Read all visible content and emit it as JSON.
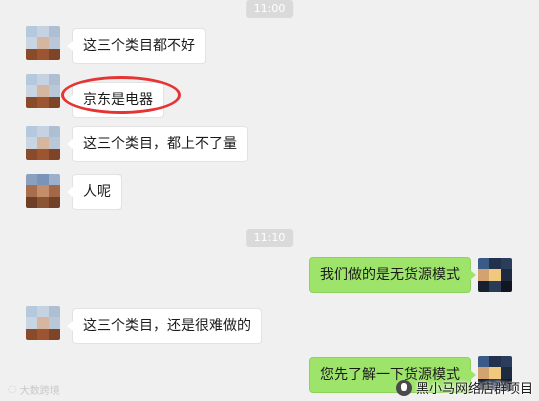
{
  "timestamps": [
    "11:00",
    "11:10"
  ],
  "messages": [
    {
      "side": "left",
      "text": "这三个类目都不好"
    },
    {
      "side": "left",
      "text": "京东是电器"
    },
    {
      "side": "left",
      "text": "这三个类目，都上不了量"
    },
    {
      "side": "left",
      "text": "人呢"
    },
    {
      "side": "right",
      "text": "我们做的是无货源模式"
    },
    {
      "side": "left",
      "text": "这三个类目，还是很难做的"
    },
    {
      "side": "right",
      "text": "您先了解一下货源模式"
    }
  ],
  "watermarks": {
    "left": "大数跨境",
    "right": "黑小马网络店群项目"
  },
  "colors": {
    "background": "#f0f0f0",
    "bubble_left": "#ffffff",
    "bubble_right": "#9ee46a",
    "highlight_circle": "#e53434"
  }
}
